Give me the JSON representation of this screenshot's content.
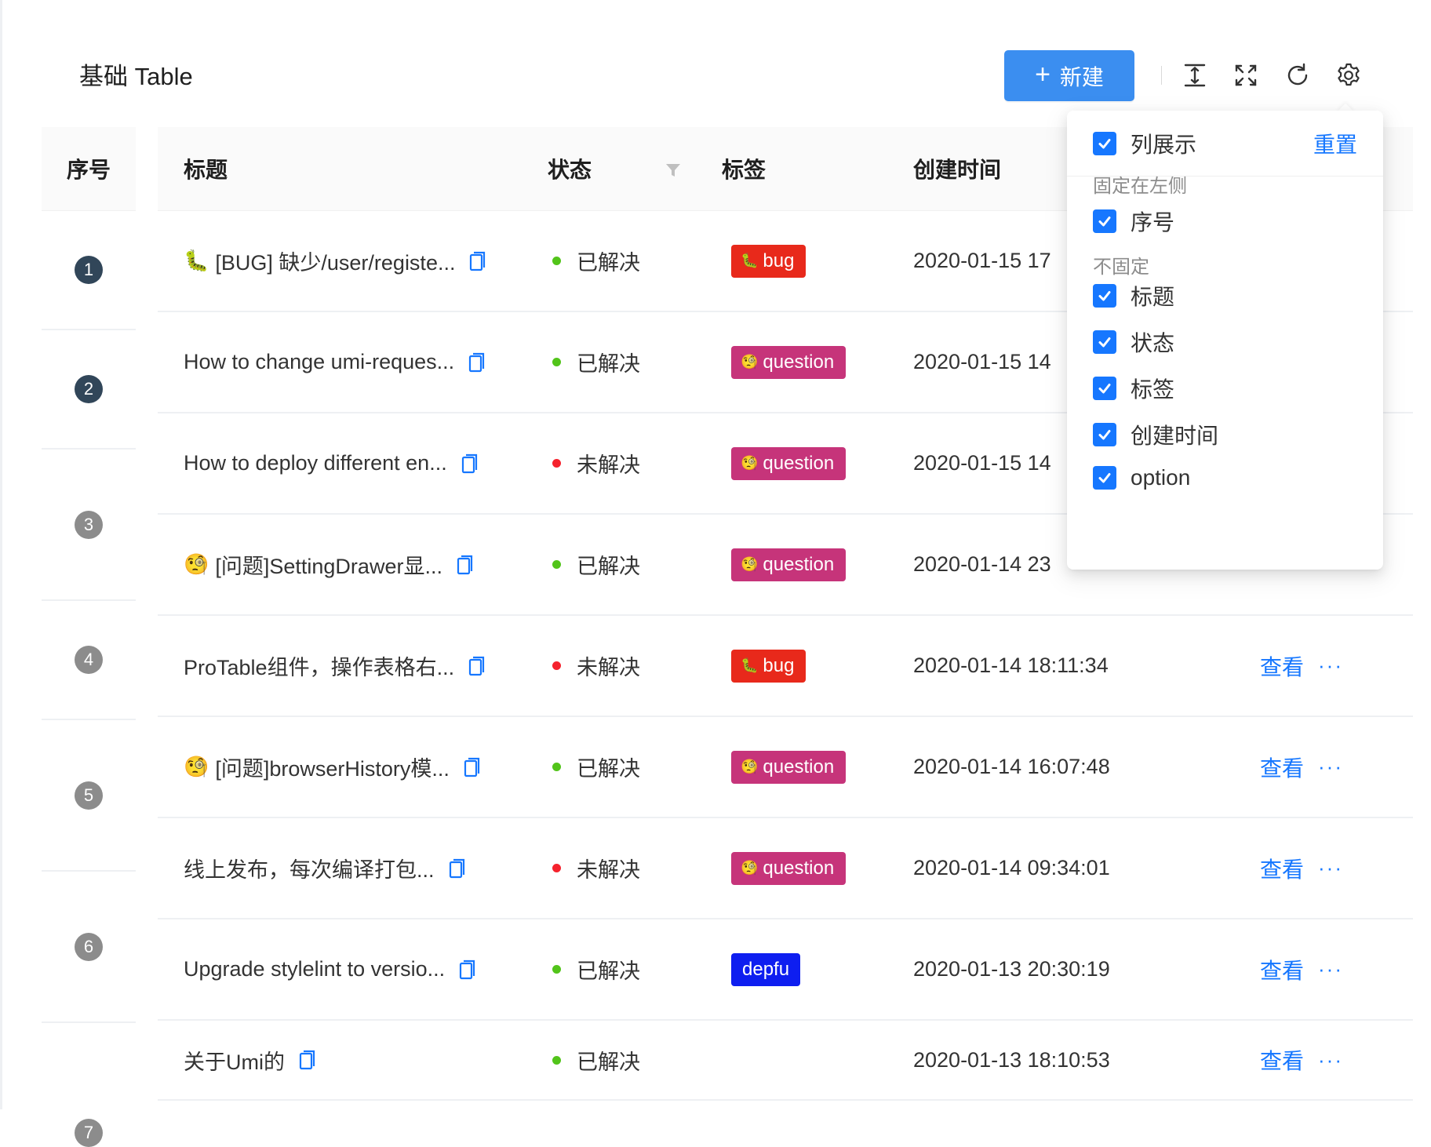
{
  "toolbar": {
    "title": "基础 Table",
    "new_button": "新建",
    "icons": [
      "column-height-icon",
      "fullscreen-icon",
      "reload-icon",
      "setting-icon"
    ]
  },
  "columns": {
    "index": "序号",
    "title": "标题",
    "status": "状态",
    "tags": "标签",
    "created_at": "创建时间"
  },
  "index_badges": [
    "1",
    "2",
    "3",
    "4",
    "5",
    "6",
    "7"
  ],
  "rows": [
    {
      "title_emoji": "🐛",
      "title": "[BUG] 缺少/user/registe...",
      "status": "已解决",
      "status_color": "#52c41a",
      "tag": "bug",
      "tag_emoji": "🐛",
      "tag_color": "#e8291b",
      "time": "2020-01-15 17",
      "view": "",
      "more": ""
    },
    {
      "title_emoji": "",
      "title": "How to change umi-reques...",
      "status": "已解决",
      "status_color": "#52c41a",
      "tag": "question",
      "tag_emoji": "🧐",
      "tag_color": "#c6347a",
      "time": "2020-01-15 14",
      "view": "",
      "more": ""
    },
    {
      "title_emoji": "",
      "title": "How to deploy different en...",
      "status": "未解决",
      "status_color": "#f5222d",
      "tag": "question",
      "tag_emoji": "🧐",
      "tag_color": "#c6347a",
      "time": "2020-01-15 14",
      "view": "",
      "more": ""
    },
    {
      "title_emoji": "🧐",
      "title": "[问题]SettingDrawer显...",
      "status": "已解决",
      "status_color": "#52c41a",
      "tag": "question",
      "tag_emoji": "🧐",
      "tag_color": "#c6347a",
      "time": "2020-01-14 23",
      "view": "",
      "more": ""
    },
    {
      "title_emoji": "",
      "title": "ProTable组件，操作表格右...",
      "status": "未解决",
      "status_color": "#f5222d",
      "tag": "bug",
      "tag_emoji": "🐛",
      "tag_color": "#e8291b",
      "time": "2020-01-14 18:11:34",
      "view": "查看",
      "more": "···"
    },
    {
      "title_emoji": "🧐",
      "title": "[问题]browserHistory模...",
      "status": "已解决",
      "status_color": "#52c41a",
      "tag": "question",
      "tag_emoji": "🧐",
      "tag_color": "#c6347a",
      "time": "2020-01-14 16:07:48",
      "view": "查看",
      "more": "···"
    },
    {
      "title_emoji": "",
      "title": "线上发布，每次编译打包...",
      "status": "未解决",
      "status_color": "#f5222d",
      "tag": "question",
      "tag_emoji": "🧐",
      "tag_color": "#c6347a",
      "time": "2020-01-14 09:34:01",
      "view": "查看",
      "more": "···"
    },
    {
      "title_emoji": "",
      "title": "Upgrade stylelint to versio...",
      "status": "已解决",
      "status_color": "#52c41a",
      "tag": "depfu",
      "tag_emoji": "",
      "tag_color": "#0e1ef0",
      "time": "2020-01-13 20:30:19",
      "view": "查看",
      "more": "···"
    },
    {
      "title_emoji": "",
      "title": "关于Umi的",
      "status": "已解决",
      "status_color": "#52c41a",
      "tag": "",
      "tag_emoji": "",
      "tag_color": "",
      "time": "2020-01-13 18:10:53",
      "view": "查看",
      "more": "···"
    }
  ],
  "column_settings": {
    "header_label": "列展示",
    "reset_label": "重置",
    "group_fixed_left": "固定在左侧",
    "group_unfixed": "不固定",
    "fixed_items": [
      "序号"
    ],
    "unfixed_items": [
      "标题",
      "状态",
      "标签",
      "创建时间",
      "option"
    ]
  },
  "colors": {
    "primary": "#1677ff",
    "new_button": "#3b8ef0",
    "resolved": "#52c41a",
    "unresolved": "#f5222d",
    "tag_bug": "#e8291b",
    "tag_question": "#c6347a",
    "tag_depfu": "#0e1ef0"
  }
}
